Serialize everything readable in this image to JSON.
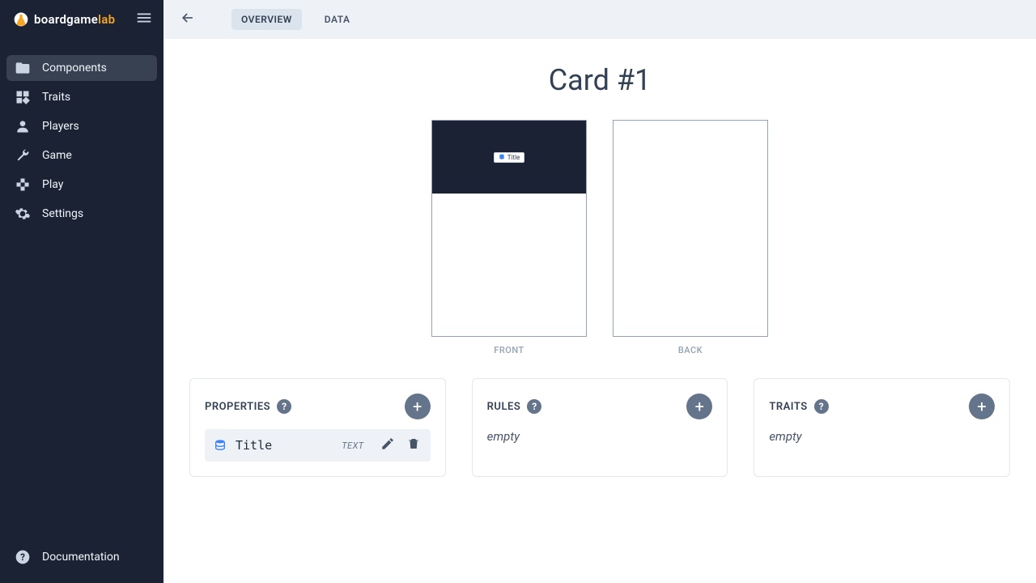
{
  "brand": {
    "name_prefix": "boardgame",
    "name_suffix": "lab"
  },
  "sidebar": {
    "items": [
      {
        "label": "Components",
        "icon": "folder-icon",
        "active": true
      },
      {
        "label": "Traits",
        "icon": "widgets-icon",
        "active": false
      },
      {
        "label": "Players",
        "icon": "person-icon",
        "active": false
      },
      {
        "label": "Game",
        "icon": "wrench-icon",
        "active": false
      },
      {
        "label": "Play",
        "icon": "gamepad-icon",
        "active": false
      },
      {
        "label": "Settings",
        "icon": "gear-icon",
        "active": false
      }
    ],
    "footer": {
      "label": "Documentation",
      "icon": "help-icon"
    }
  },
  "topbar": {
    "tabs": [
      {
        "label": "OVERVIEW",
        "active": true
      },
      {
        "label": "DATA",
        "active": false
      }
    ]
  },
  "page": {
    "title": "Card #1",
    "front_caption": "FRONT",
    "back_caption": "BACK",
    "front_chip_label": "Title"
  },
  "panels": {
    "properties": {
      "title": "PROPERTIES",
      "items": [
        {
          "name": "Title",
          "type": "TEXT"
        }
      ]
    },
    "rules": {
      "title": "RULES",
      "empty": "empty"
    },
    "traits": {
      "title": "TRAITS",
      "empty": "empty"
    }
  }
}
